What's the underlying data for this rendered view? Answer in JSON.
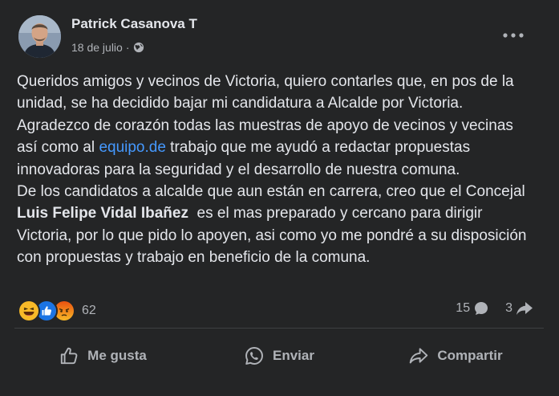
{
  "post": {
    "author": "Patrick Casanova T",
    "date": "18 de julio",
    "separator": "·",
    "privacy_icon": "globe-icon",
    "menu_icon": "more-options-icon",
    "body": {
      "p1_before_link": "Queridos amigos y vecinos de Victoria, quiero contarles que, en pos de la unidad, se ha decidido bajar mi candidatura a Alcalde por Victoria. Agradezco de corazón todas las muestras de apoyo de vecinos y vecinas así como al ",
      "p1_link": "equipo.de",
      "p1_after_link": " trabajo que me ayudó a redactar propuestas innovadoras para la seguridad y el desarrollo de nuestra comuna.",
      "p2_before_mention": "De los candidatos a alcalde que aun están en carrera, creo que el Concejal ",
      "p2_mention": "Luis Felipe Vidal Ibañez",
      "p2_after_mention": "  es el mas preparado y cercano para dirigir Victoria, por lo que pido lo apoyen, asi como yo me pondré a su disposición con propuestas y trabajo en beneficio de la comuna."
    }
  },
  "reactions": {
    "icons": [
      "haha-icon",
      "like-icon",
      "angry-icon"
    ],
    "count": "62"
  },
  "stats": {
    "comments": "15",
    "shares": "3"
  },
  "actions": {
    "like": "Me gusta",
    "send": "Enviar",
    "share": "Compartir"
  },
  "colors": {
    "card_bg": "#242526",
    "text_primary": "#e4e6eb",
    "text_secondary": "#b0b3b8",
    "link": "#4599ff",
    "like_blue": "#1b74e4",
    "haha_yellow": "#f7b928",
    "angry_orange": "#e9710f"
  }
}
